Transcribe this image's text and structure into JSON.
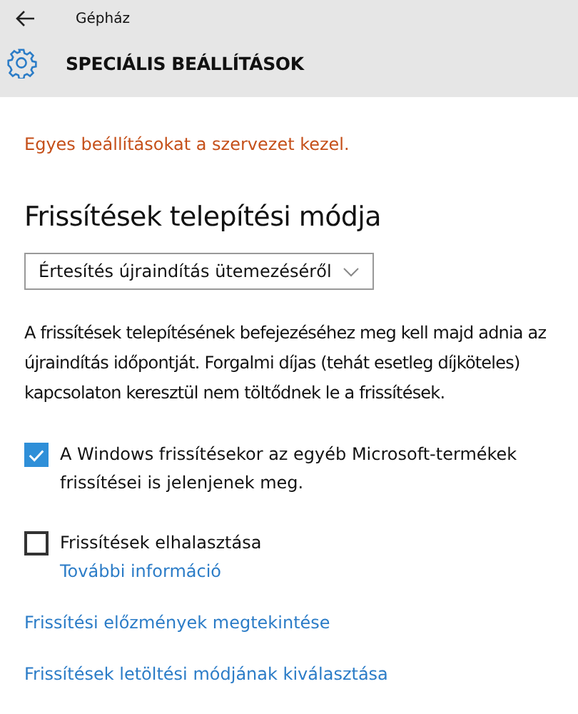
{
  "window": {
    "app_title": "Gépház"
  },
  "header": {
    "title": "SPECIÁLIS BEÁLLÍTÁSOK"
  },
  "warning": "Egyes beállításokat a szervezet kezel.",
  "section": {
    "heading": "Frissítések telepítési módja",
    "dropdown": {
      "value": "Értesítés újraindítás ütemezéséről"
    },
    "description": "A frissítések telepítésének befejezéséhez meg kell majd adnia az újraindítás időpontját. Forgalmi díjas (tehát esetleg díjköteles) kapcsolaton keresztül nem töltődnek le a frissítések.",
    "checkboxes": [
      {
        "label": "A Windows frissítésekor az egyéb Microsoft-termékek frissítései is jelenjenek meg.",
        "checked": true
      },
      {
        "label": "Frissítések elhalasztása",
        "checked": false,
        "link": "További információ"
      }
    ],
    "links": [
      "Frissítési előzmények megtekintése",
      "Frissítések letöltési módjának kiválasztása"
    ]
  }
}
